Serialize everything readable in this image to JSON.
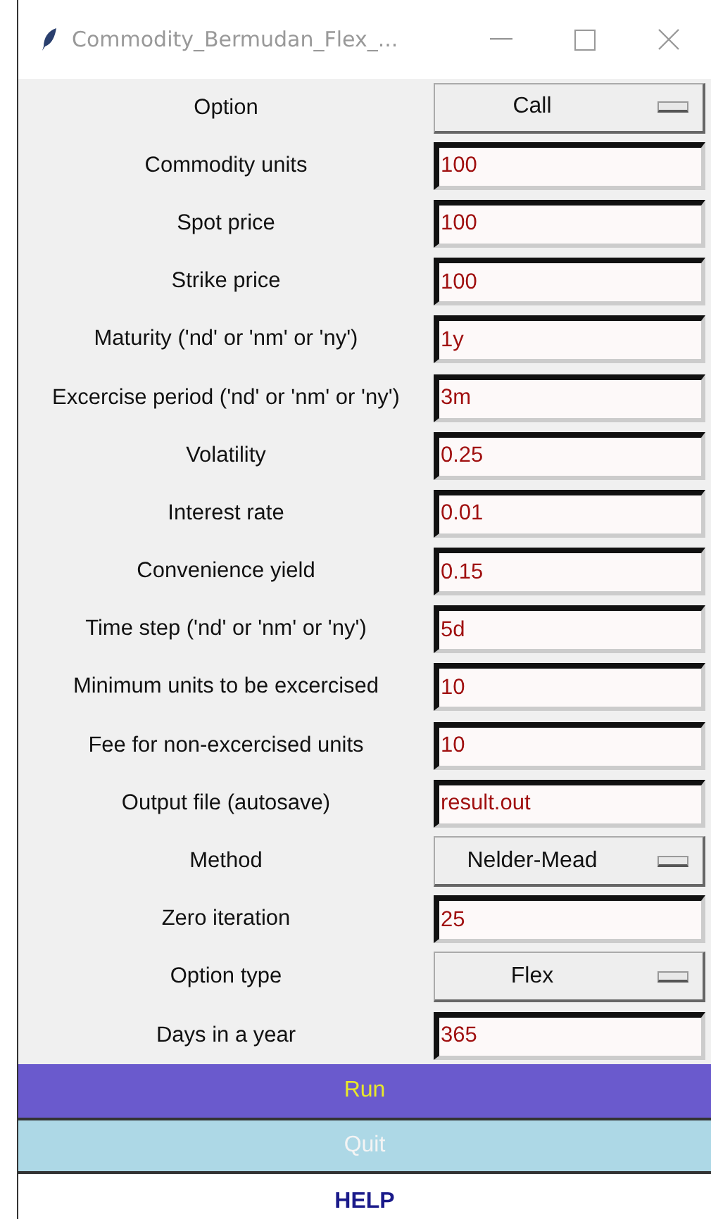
{
  "window": {
    "title": "Commodity_Bermudan_Flex_..."
  },
  "rows": [
    {
      "label": "Option",
      "kind": "dropdown",
      "value": "Call"
    },
    {
      "label": "Commodity units",
      "kind": "entry",
      "value": "100"
    },
    {
      "label": "Spot price",
      "kind": "entry",
      "value": "100"
    },
    {
      "label": "Strike price",
      "kind": "entry",
      "value": "100"
    },
    {
      "label": "Maturity ('nd' or 'nm' or 'ny')",
      "kind": "entry",
      "value": "1y"
    },
    {
      "label": "Excercise period ('nd' or 'nm' or 'ny')",
      "kind": "entry",
      "value": "3m"
    },
    {
      "label": "Volatility",
      "kind": "entry",
      "value": "0.25"
    },
    {
      "label": "Interest rate",
      "kind": "entry",
      "value": "0.01"
    },
    {
      "label": "Convenience yield",
      "kind": "entry",
      "value": "0.15"
    },
    {
      "label": "Time step ('nd' or 'nm' or 'ny')",
      "kind": "entry",
      "value": "5d"
    },
    {
      "label": "Minimum units  to be excercised",
      "kind": "entry",
      "value": "10"
    },
    {
      "label": "Fee for non-excercised units",
      "kind": "entry",
      "value": "10"
    },
    {
      "label": "Output file (autosave)",
      "kind": "entry",
      "value": "result.out"
    },
    {
      "label": "Method",
      "kind": "dropdown",
      "value": "Nelder-Mead"
    },
    {
      "label": "Zero iteration",
      "kind": "entry",
      "value": "25"
    },
    {
      "label": "Option type",
      "kind": "dropdown",
      "value": "Flex"
    },
    {
      "label": "Days in a year",
      "kind": "entry",
      "value": "365"
    }
  ],
  "buttons": [
    {
      "label": "Run",
      "kind": "run"
    },
    {
      "label": "Quit",
      "kind": "quit"
    },
    {
      "label": "HELP",
      "kind": "help"
    }
  ]
}
